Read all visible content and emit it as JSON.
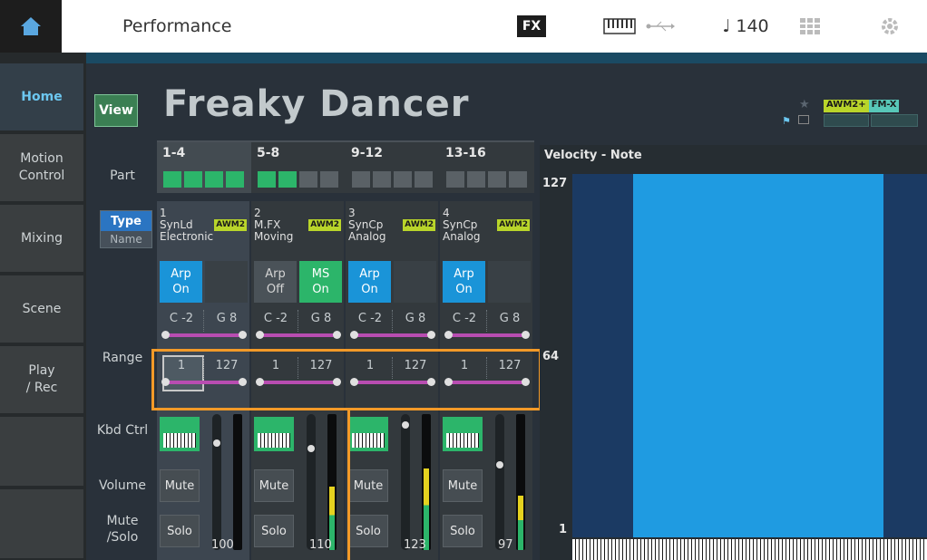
{
  "topbar": {
    "title": "Performance",
    "fx_label": "FX",
    "tempo": "♩ 140",
    "icons": [
      "home-icon",
      "keyboard-icon",
      "usb-icon",
      "grid-icon",
      "gear-icon"
    ]
  },
  "sidebar": {
    "items": [
      {
        "label": "Home"
      },
      {
        "label": "Motion\nControl"
      },
      {
        "label": "Mixing"
      },
      {
        "label": "Scene"
      },
      {
        "label": "Play\n/ Rec"
      }
    ]
  },
  "header": {
    "view_label": "View",
    "performance_name": "Freaky Dancer",
    "badge_awm": "AWM2+",
    "badge_fm": "FM-X"
  },
  "row_labels": {
    "part": "Part",
    "range": "Range",
    "kbd_ctrl": "Kbd Ctrl",
    "volume": "Volume",
    "mute_solo": "Mute\n/Solo",
    "type": "Type",
    "name": "Name"
  },
  "groups": [
    {
      "label": "1-4",
      "squares": [
        true,
        true,
        true,
        true
      ]
    },
    {
      "label": "5-8",
      "squares": [
        true,
        true,
        false,
        false
      ]
    },
    {
      "label": "9-12",
      "squares": [
        false,
        false,
        false,
        false
      ]
    },
    {
      "label": "13-16",
      "squares": [
        false,
        false,
        false,
        false
      ]
    }
  ],
  "parts": [
    {
      "num": "1",
      "cat": "SynLd",
      "sub": "Electronic",
      "engine": "AWM2",
      "btn1": [
        "Arp",
        "On"
      ],
      "btn2": null,
      "note_lo": "C -2",
      "note_hi": "G 8",
      "vel_lo": "1",
      "vel_hi": "127",
      "mute": "Mute",
      "solo": "Solo",
      "volume": "100"
    },
    {
      "num": "2",
      "cat": "M.FX",
      "sub": "Moving",
      "engine": "AWM2",
      "btn1": [
        "Arp",
        "Off"
      ],
      "btn2": [
        "MS",
        "On"
      ],
      "note_lo": "C -2",
      "note_hi": "G 8",
      "vel_lo": "1",
      "vel_hi": "127",
      "mute": "Mute",
      "solo": "Solo",
      "volume": "110"
    },
    {
      "num": "3",
      "cat": "SynCp",
      "sub": "Analog",
      "engine": "AWM2",
      "btn1": [
        "Arp",
        "On"
      ],
      "btn2": null,
      "note_lo": "C -2",
      "note_hi": "G 8",
      "vel_lo": "1",
      "vel_hi": "127",
      "mute": "Mute",
      "solo": "Solo",
      "volume": "123"
    },
    {
      "num": "4",
      "cat": "SynCp",
      "sub": "Analog",
      "engine": "AWM2",
      "btn1": [
        "Arp",
        "On"
      ],
      "btn2": null,
      "note_lo": "C -2",
      "note_hi": "G 8",
      "vel_lo": "1",
      "vel_hi": "127",
      "mute": "Mute",
      "solo": "Solo",
      "volume": "97"
    }
  ],
  "graph": {
    "title": "Velocity - Note",
    "y_top": "127",
    "y_mid": "64",
    "y_bottom": "1"
  }
}
